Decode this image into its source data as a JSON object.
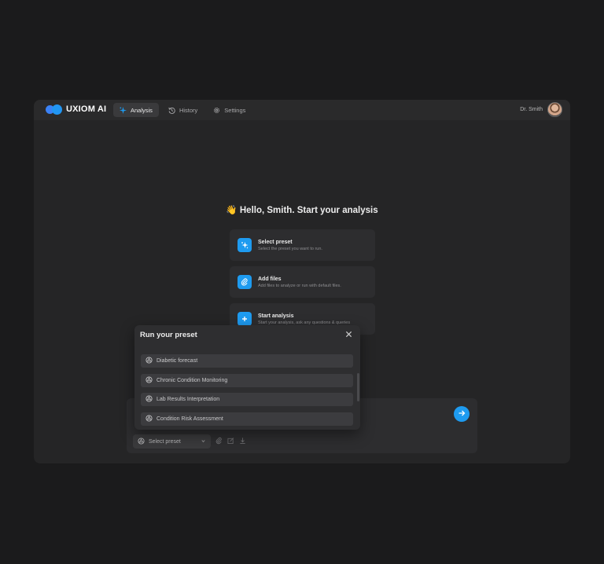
{
  "brand": {
    "name": "UXIOM AI"
  },
  "nav": {
    "items": [
      {
        "label": "Analysis",
        "icon": "sparkle-icon",
        "active": true
      },
      {
        "label": "History",
        "icon": "history-icon",
        "active": false
      },
      {
        "label": "Settings",
        "icon": "gear-icon",
        "active": false
      }
    ]
  },
  "user": {
    "name": "Dr. Smith"
  },
  "main": {
    "greeting": "👋 Hello, Smith. Start your analysis",
    "steps": [
      {
        "title": "Select preset",
        "subtitle": "Select the preset you want to run.",
        "icon": "sparkle-icon"
      },
      {
        "title": "Add files",
        "subtitle": "Add files to analyze or run with default files.",
        "icon": "paperclip-icon"
      },
      {
        "title": "Start analysis",
        "subtitle": "Start your analysis, ask any questions & queries",
        "icon": "plus-icon"
      }
    ]
  },
  "composer": {
    "preset_select_label": "Select preset",
    "send_icon": "arrow-right-icon"
  },
  "modal": {
    "title": "Run your preset",
    "presets": [
      {
        "label": "Diabetic forecast"
      },
      {
        "label": "Chronic Condition Monitoring"
      },
      {
        "label": "Lab Results Interpretation"
      },
      {
        "label": "Condition Risk Assessment"
      }
    ]
  },
  "colors": {
    "accent": "#1e9bf0",
    "background": "#1b1b1c",
    "panel": "#252526"
  }
}
